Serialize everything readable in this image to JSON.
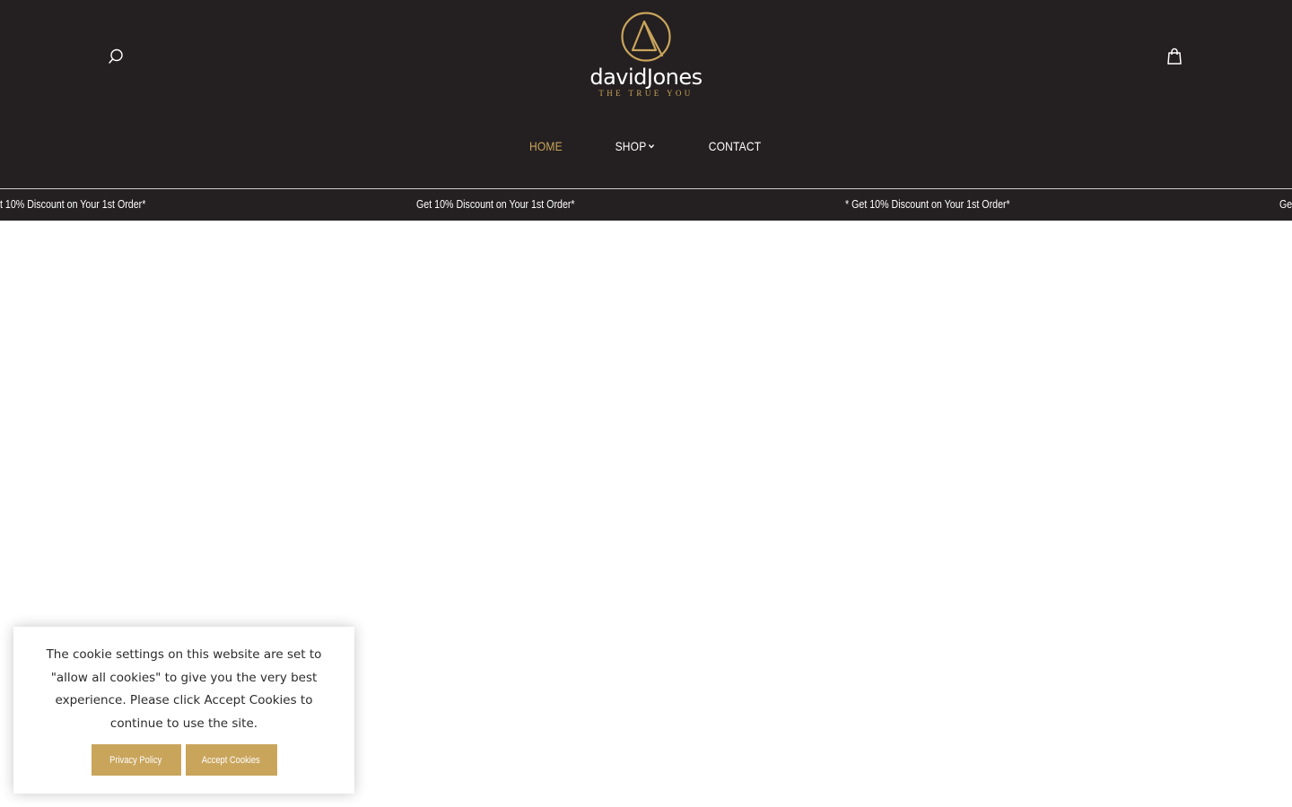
{
  "brand": {
    "wordmark": "davidJones",
    "tagline": "THE TRUE YOU",
    "accent_color": "#c9a55c",
    "header_bg": "#241f20"
  },
  "header": {
    "search_icon": "search-icon",
    "cart_icon": "shopping-bag-icon"
  },
  "nav": {
    "items": [
      {
        "label": "HOME",
        "active": true
      },
      {
        "label": "SHOP",
        "has_dropdown": true
      },
      {
        "label": "CONTACT"
      }
    ]
  },
  "promo": {
    "items": [
      "t 10% Discount on Your 1st Order*",
      "Get 10% Discount on Your 1st Order*",
      "* Get 10% Discount on Your 1st Order*",
      "Ge"
    ]
  },
  "cookie": {
    "message": "The cookie settings on this website are set to \"allow all cookies\" to give you the very best experience. Please click Accept Cookies to continue to use the site.",
    "privacy_label": "Privacy Policy",
    "accept_label": "Accept Cookies"
  }
}
